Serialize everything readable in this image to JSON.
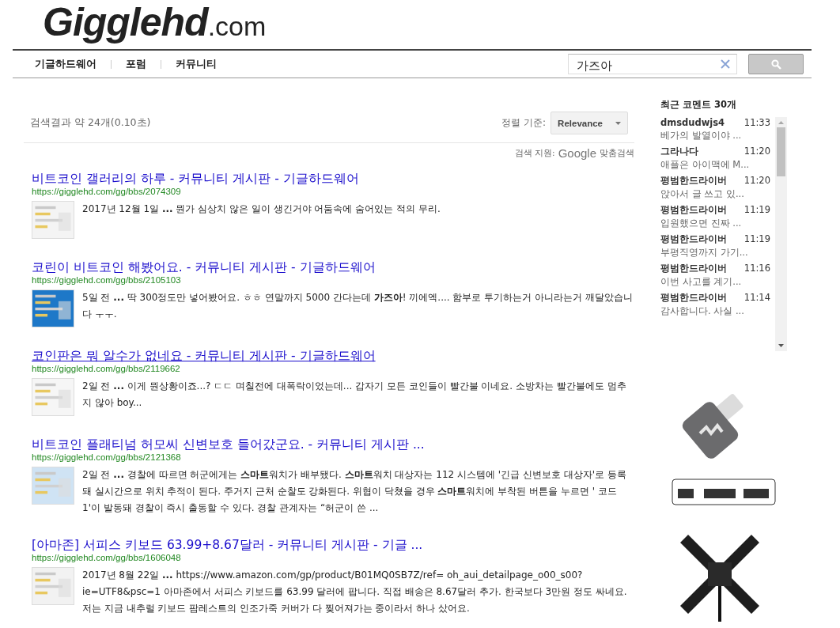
{
  "logo": {
    "name": "Gigglehd",
    "suffix": ".com"
  },
  "nav": [
    "기글하드웨어",
    "포럼",
    "커뮤니티"
  ],
  "search": {
    "value": "가즈아"
  },
  "summary": "검색결과 약 24개(0.10초)",
  "sort": {
    "label": "정렬 기준:",
    "value": "Relevance"
  },
  "powered": {
    "label": "검색 지원:",
    "brand": "Google",
    "suffix": "맞춤검색"
  },
  "results": [
    {
      "title": "비트코인 갤러리의 하루 - 커뮤니티 게시판 - 기글하드웨어",
      "url": "https://gigglehd.com/gg/bbs/2074309",
      "snippet": "2017년 12월 1일 **...** 뭔가 심상치 않은 일이 생긴거야 어둠속에 숨어있는 적의 무리.",
      "hovered": false
    },
    {
      "title": "코린이 비트코인 해봤어요. - 커뮤니티 게시판 - 기글하드웨어",
      "url": "https://gigglehd.com/gg/bbs/2105103",
      "snippet": "5일 전 **...** 딱 300정도만 넣어봤어요. ㅎㅎ 연말까지 5000 간다는데 **가즈아**! 끼에엑.... 함부로 투기하는거 아니라는거 깨달았습니다 ㅜㅜ.",
      "hovered": false
    },
    {
      "title": "코인판은 뭐 알수가 없네요 - 커뮤니티 게시판 - 기글하드웨어",
      "url": "https://gigglehd.com/gg/bbs/2119662",
      "snippet": "2일 전 **...** 이게 뭔상황이죠...? ㄷㄷ 며칠전에 대폭락이었는데... 갑자기 모든 코인들이 빨간불 이네요. 소방차는 빨간불에도 멈추지 않아 boy...",
      "hovered": true
    },
    {
      "title": "비트코인 플래티넘 허모씨 신변보호 들어갔군요. - 커뮤니티 게시판 ...",
      "url": "https://gigglehd.com/gg/bbs/2121368",
      "snippet": "2일 전 **...** 경찰에 따르면 허군에게는 **스마트**워치가 배부됐다. **스마트**워치 대상자는 112 시스템에 '긴급 신변보호 대상자'로 등록돼 실시간으로 위치 추적이 된다. 주거지 근처 순찰도 강화된다. 위협이 닥쳤을 경우 **스마트**워치에 부착된 버튼을 누르면 ' 코드1'이 발동돼 경찰이 즉시 출동할 수 있다. 경찰 관계자는 “허군이 쓴 ...",
      "hovered": false
    },
    {
      "title": "[아마존] 서피스 키보드 63.99+8.67달러 - 커뮤니티 게시판 - 기글 ...",
      "url": "https://gigglehd.com/gg/bbs/1606048",
      "snippet": "2017년 8월 22일 **...** https://www.amazon.com/gp/product/B01MQ0SB7Z/ref= oh_aui_detailpage_o00_s00?ie=UTF8&psc=1 아마존에서 서피스 키보드를 63.99 달러에 팝니다. 직접 배송은 8.67달러 추가. 한국보다 3만원 정도 싸네요. 저는 지금 내추럴 키보드 팜레스트의 인조가죽 커버가 다 찢어져가는 중이라서 하나 샀어요.",
      "hovered": false
    }
  ],
  "sidebar": {
    "title": "최근 코멘트 30개",
    "comments": [
      {
        "user": "dmsdudwjs4",
        "time": "11:33",
        "text": "베가의 발열이야 ..."
      },
      {
        "user": "그라나다",
        "time": "11:20",
        "text": "애플은 아이맥에 M..."
      },
      {
        "user": "평범한드라이버",
        "time": "11:20",
        "text": "앉아서 글 쓰고 있..."
      },
      {
        "user": "평범한드라이버",
        "time": "11:19",
        "text": "입원했으면 진짜 ..."
      },
      {
        "user": "평범한드라이버",
        "time": "11:19",
        "text": "부평직영까지 가기..."
      },
      {
        "user": "평범한드라이버",
        "time": "11:16",
        "text": "이번 사고를 계기..."
      },
      {
        "user": "평범한드라이버",
        "time": "11:14",
        "text": "감사합니다. 사실 ..."
      }
    ]
  }
}
